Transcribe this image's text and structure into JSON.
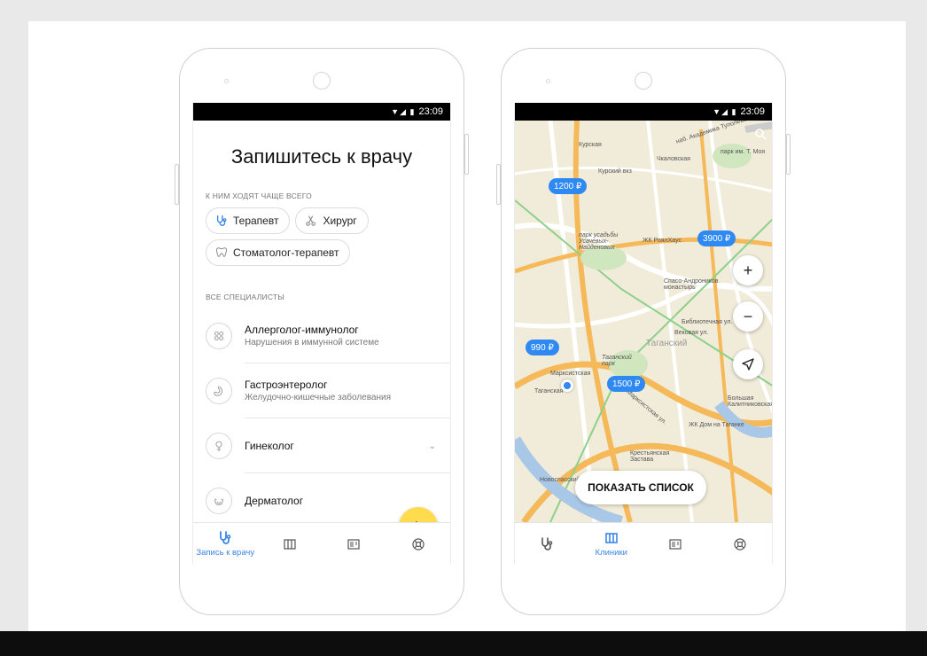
{
  "status_time": "23:09",
  "screen1": {
    "title": "Запишитесь к врачу",
    "popular_label": "К ним ходят чаще всего",
    "popular_chips": [
      {
        "label": "Терапевт",
        "icon": "stethoscope-icon"
      },
      {
        "label": "Хирург",
        "icon": "scissors-icon"
      },
      {
        "label": "Стоматолог-терапевт",
        "icon": "tooth-icon"
      }
    ],
    "all_label": "Все специалисты",
    "specialists": [
      {
        "name": "Аллерголог-иммунолог",
        "desc": "Нарушения в иммунной системе",
        "icon": "allergy-icon"
      },
      {
        "name": "Гастроэнтеролог",
        "desc": "Желудочно-кишечные заболевания",
        "icon": "stomach-icon"
      },
      {
        "name": "Гинеколог",
        "desc": "",
        "icon": "female-icon"
      },
      {
        "name": "Дерматолог",
        "desc": "",
        "icon": "skin-icon"
      }
    ],
    "active_tab_label": "Запись к врачу"
  },
  "screen2": {
    "prices": [
      "1200 ₽",
      "3900 ₽",
      "990 ₽",
      "1500 ₽"
    ],
    "map_labels": [
      "Курская",
      "Курский вкз",
      "Чкаловская",
      "наб. Академика Туполева",
      "парк им. Т. Моя",
      "парк усадьбы Усачевых-Найденовых",
      "ЖК РоялХаус",
      "Спасо-Андроников монастырь",
      "Таганский",
      "Таганский парк",
      "Марксистская",
      "Таганская",
      "Марксистская ул.",
      "Крестьянская Застава",
      "ЖК Дом на Таганке",
      "Большая Калитниковская",
      "Новоспасский",
      "Библиотечная ул.",
      "Вековая ул."
    ],
    "show_list": "ПОКАЗАТЬ СПИСОК",
    "active_tab_label": "Клиники"
  },
  "colors": {
    "accent": "#3a86e6",
    "fab": "#ffdb4d",
    "price_pin": "#2f89f2",
    "map_bg": "#f1ecd9"
  }
}
